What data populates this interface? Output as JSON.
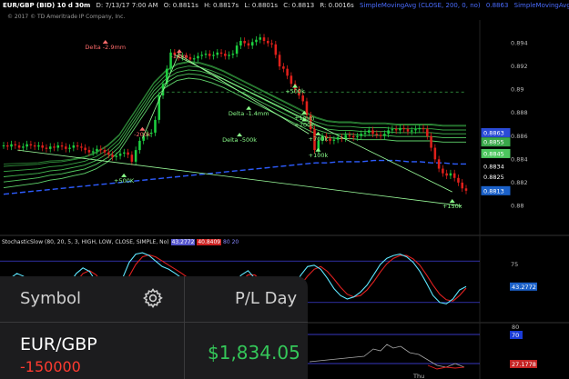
{
  "header": {
    "symbol": "EUR/GBP (BID) 10 d 30m",
    "date": "D: 7/13/17 7:00 AM",
    "open": "O: 0.8811s",
    "high": "H: 0.8817s",
    "low": "L: 0.8801s",
    "close": "C: 0.8813",
    "range": "R: 0.0016s",
    "ma1": "SimpleMovingAvg (CLOSE, 200, 0, no)",
    "ma1_value": "0.8863",
    "ma2": "SimpleMovingAvg (CLOSE,..."
  },
  "copyright": "© 2017 © TD Ameritrade IP Company, Inc.",
  "chart_data": {
    "type": "line",
    "ylim": [
      0.878,
      0.896
    ],
    "y_ticks": [
      0.894,
      0.892,
      0.89,
      0.888,
      0.886,
      0.884,
      0.882,
      0.88
    ],
    "y_tick_labels": [
      "0.894",
      "0.892",
      "0.89",
      "0.888",
      "0.886",
      "0.884",
      "0.882",
      "0.88"
    ],
    "price_badges": [
      {
        "label": "0.8863",
        "value": 0.8863,
        "color": "#2a4bd7"
      },
      {
        "label": "0.8855",
        "value": 0.8855,
        "color": "#3aa84a"
      },
      {
        "label": "0.8845",
        "value": 0.8845,
        "color": "#4cc75e"
      },
      {
        "label": "0.8834",
        "value": 0.8834,
        "color": "#000000"
      },
      {
        "label": "0.8825",
        "value": 0.8825,
        "color": "#000000"
      },
      {
        "label": "0.8813",
        "value": 0.8813,
        "color": "#1a60c8"
      }
    ],
    "price": [
      0.8852,
      0.8851,
      0.8853,
      0.8852,
      0.885,
      0.8851,
      0.8853,
      0.8852,
      0.8851,
      0.8852,
      0.885,
      0.8849,
      0.8851,
      0.885,
      0.8852,
      0.8851,
      0.8849,
      0.885,
      0.8852,
      0.8851,
      0.885,
      0.8848,
      0.8846,
      0.8847,
      0.8849,
      0.8848,
      0.8846,
      0.8844,
      0.8842,
      0.8843,
      0.8845,
      0.8846,
      0.8844,
      0.8838,
      0.8848,
      0.8856,
      0.886,
      0.8862,
      0.8863,
      0.8874,
      0.8895,
      0.8905,
      0.8918,
      0.8932,
      0.893,
      0.8928,
      0.8929,
      0.8928,
      0.8926,
      0.8927,
      0.8929,
      0.893,
      0.8931,
      0.8929,
      0.893,
      0.8932,
      0.8931,
      0.8929,
      0.893,
      0.8931,
      0.8938,
      0.8942,
      0.894,
      0.8938,
      0.8941,
      0.8943,
      0.8945,
      0.8942,
      0.894,
      0.8939,
      0.893,
      0.892,
      0.8918,
      0.8912,
      0.8905,
      0.89,
      0.8895,
      0.889,
      0.8878,
      0.8866,
      0.8848,
      0.8856,
      0.886,
      0.8858,
      0.8856,
      0.8857,
      0.8859,
      0.8858,
      0.8861,
      0.886,
      0.8859,
      0.886,
      0.8862,
      0.8863,
      0.8865,
      0.8862,
      0.8861,
      0.886,
      0.8862,
      0.8865,
      0.8866,
      0.8865,
      0.8867,
      0.8866,
      0.8864,
      0.8865,
      0.8866,
      0.8867,
      0.8866,
      0.886,
      0.885,
      0.884,
      0.8832,
      0.8828,
      0.8826,
      0.8828,
      0.8824,
      0.882,
      0.8815,
      0.8813
    ],
    "sma_long": [
      0.881,
      0.8811,
      0.8812,
      0.8813,
      0.8814,
      0.8815,
      0.8816,
      0.8817,
      0.8818,
      0.8819,
      0.882,
      0.8821,
      0.8822,
      0.8823,
      0.8824,
      0.8825,
      0.8826,
      0.8827,
      0.8828,
      0.8829,
      0.883,
      0.8831,
      0.8832,
      0.8833,
      0.8834,
      0.8835,
      0.8836,
      0.8837,
      0.8837,
      0.8838,
      0.8838,
      0.8838,
      0.8839,
      0.8839,
      0.8839,
      0.8838,
      0.8838,
      0.8837,
      0.8837,
      0.8836,
      0.8836
    ],
    "sma_mid": [
      0.8826,
      0.8827,
      0.8828,
      0.8829,
      0.8831,
      0.8832,
      0.8834,
      0.8836,
      0.884,
      0.8846,
      0.8855,
      0.887,
      0.8885,
      0.89,
      0.891,
      0.8916,
      0.8918,
      0.8917,
      0.8914,
      0.891,
      0.8905,
      0.89,
      0.8895,
      0.889,
      0.8885,
      0.888,
      0.8875,
      0.887,
      0.8867,
      0.8866,
      0.8866,
      0.8865,
      0.8865,
      0.8865,
      0.8864,
      0.8864,
      0.8864,
      0.8864,
      0.8863,
      0.8863,
      0.8863
    ],
    "annotations": [
      {
        "text": "Delta -2.9mm",
        "color": "#ff6b6b",
        "x": 0.22,
        "value": 0.8935
      },
      {
        "text": "-1.3m",
        "color": "#ff6b6b",
        "x": 0.38,
        "value": 0.8927
      },
      {
        "text": "-200k",
        "color": "#ff6b6b",
        "x": 0.3,
        "value": 0.886
      },
      {
        "text": "+500K",
        "color": "#8bff8b",
        "x": 0.26,
        "value": 0.882
      },
      {
        "text": "+500k",
        "color": "#8bff8b",
        "x": 0.63,
        "value": 0.8897
      },
      {
        "text": "Delta -1.4mm",
        "color": "#8bff8b",
        "x": 0.53,
        "value": 0.8878
      },
      {
        "text": "+1mm",
        "color": "#8bff8b",
        "x": 0.65,
        "value": 0.8874
      },
      {
        "text": "+200k",
        "color": "#8bff8b",
        "x": 0.65,
        "value": 0.8868
      },
      {
        "text": "Delta -500k",
        "color": "#8bff8b",
        "x": 0.51,
        "value": 0.8855
      },
      {
        "text": "+700k",
        "color": "#8bff8b",
        "x": 0.68,
        "value": 0.8856
      },
      {
        "text": "+100k",
        "color": "#8bff8b",
        "x": 0.68,
        "value": 0.8842
      },
      {
        "text": "+150k",
        "color": "#8bff8b",
        "x": 0.97,
        "value": 0.8798
      }
    ],
    "stochastic": {
      "title": "StochasticSlow (80, 20, 5, 3, HIGH, LOW, CLOSE, SIMPLE, No)",
      "k_label": "43.2772",
      "d_label": "40.8409",
      "extra_label": "80",
      "extra_label2": "20",
      "ticks": [
        "75",
        "43.2772"
      ],
      "k": [
        50,
        55,
        62,
        58,
        45,
        30,
        22,
        18,
        20,
        30,
        48,
        62,
        70,
        65,
        50,
        35,
        25,
        30,
        55,
        78,
        90,
        92,
        88,
        80,
        72,
        68,
        62,
        55,
        48,
        40,
        35,
        32,
        30,
        35,
        42,
        50,
        60,
        66,
        55,
        40,
        28,
        22,
        25,
        32,
        45,
        60,
        72,
        74,
        68,
        55,
        40,
        30,
        25,
        28,
        35,
        45,
        60,
        75,
        84,
        88,
        90,
        86,
        78,
        65,
        48,
        30,
        20,
        18,
        25,
        38,
        43
      ],
      "d": [
        48,
        52,
        56,
        57,
        52,
        42,
        32,
        24,
        20,
        24,
        35,
        50,
        62,
        66,
        60,
        48,
        36,
        30,
        40,
        58,
        75,
        86,
        89,
        86,
        80,
        74,
        68,
        62,
        55,
        48,
        41,
        36,
        33,
        33,
        37,
        44,
        52,
        60,
        60,
        52,
        40,
        30,
        25,
        27,
        34,
        46,
        58,
        68,
        72,
        65,
        54,
        42,
        32,
        28,
        30,
        38,
        50,
        64,
        76,
        84,
        88,
        88,
        83,
        74,
        60,
        45,
        32,
        24,
        22,
        30,
        40.8
      ]
    },
    "lower_panel": {
      "ticks": [
        "80",
        "70",
        "27.1778"
      ]
    }
  },
  "overlay": {
    "symbol_header": "Symbol",
    "pl_header": "P/L Day",
    "pair": "EUR/GBP",
    "quantity": "-150000",
    "pl_value": "$1,834.05"
  },
  "x_label": "Thu"
}
